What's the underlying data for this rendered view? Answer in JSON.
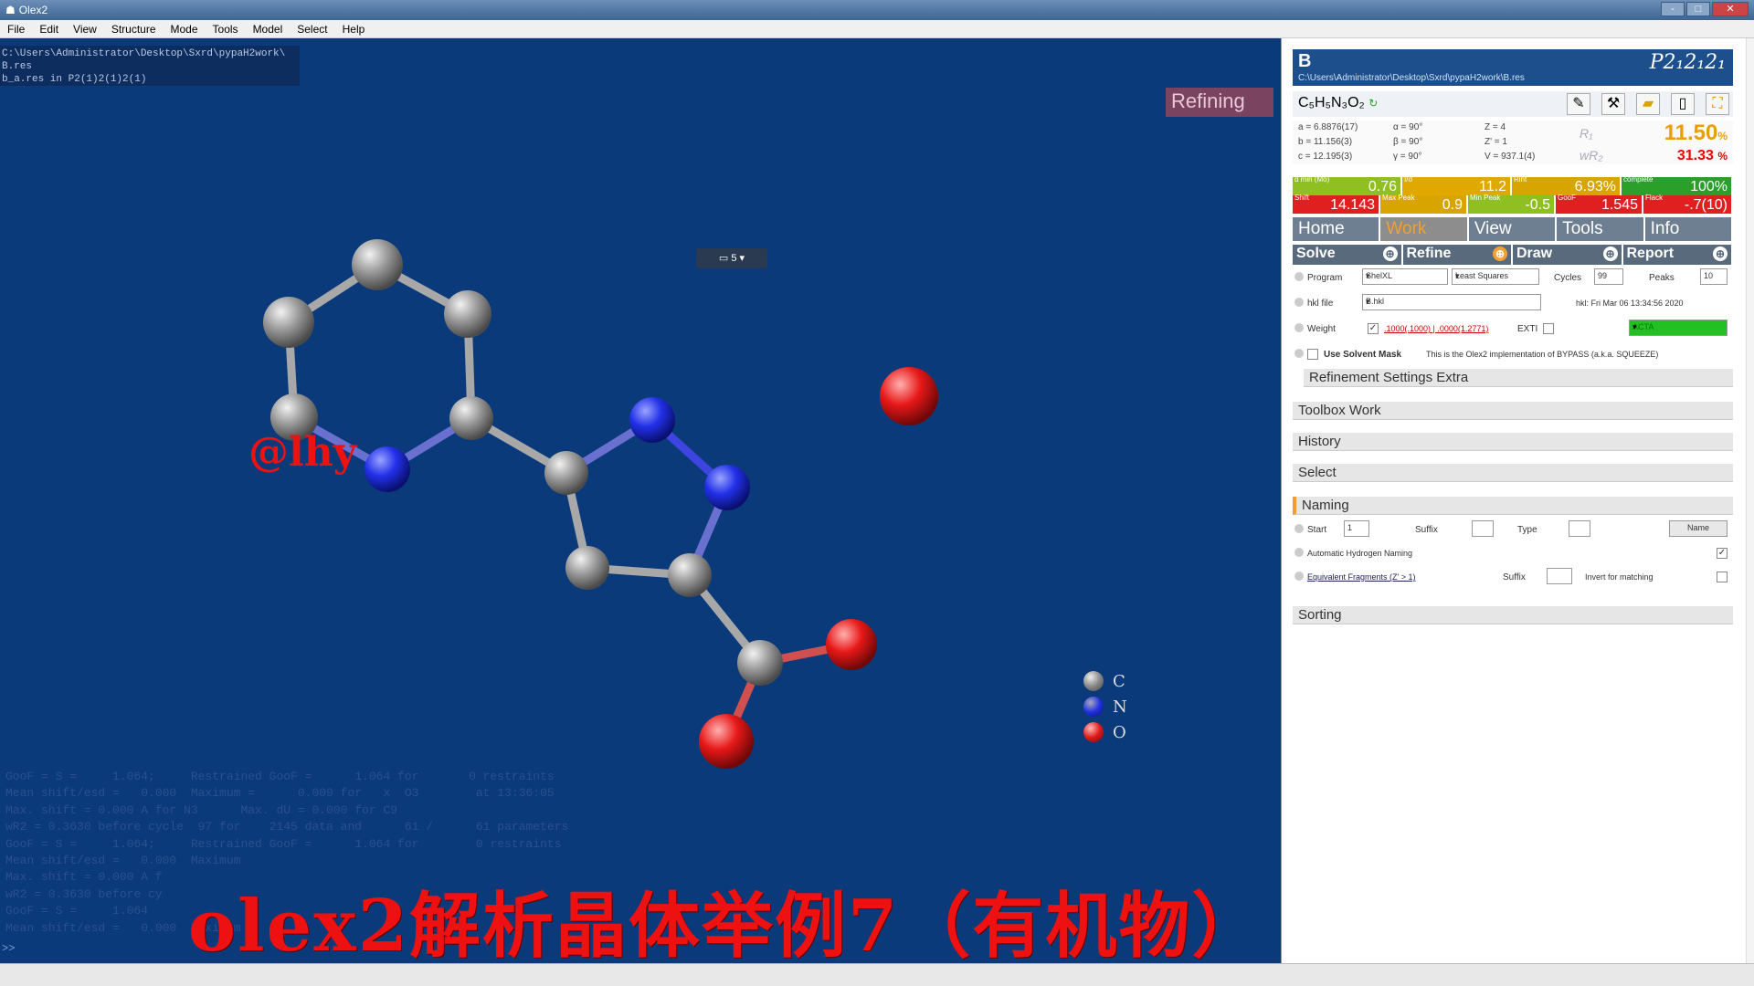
{
  "window": {
    "title": "Olex2",
    "min": "-",
    "max": "□",
    "close": "✕"
  },
  "menu": [
    "File",
    "Edit",
    "View",
    "Structure",
    "Mode",
    "Tools",
    "Model",
    "Select",
    "Help"
  ],
  "console_top": {
    "line1": "C:\\Users\\Administrator\\Desktop\\Sxrd\\pypaH2work\\",
    "line2": "B.res",
    "line3": "b_a.res  in P2(1)2(1)2(1)"
  },
  "refining_label": "Refining",
  "console_bottom": "GooF = S =     1.064;     Restrained GooF =      1.064 for       0 restraints\nMean shift/esd =   0.000  Maximum =      0.009 for   x  O3        at 13:36:05\nMax. shift = 0.000 A for N3      Max. dU = 0.000 for C9\nwR2 = 0.3630 before cycle  97 for    2145 data and      61 /      61 parameters\nGooF = S =     1.064;     Restrained GooF =      1.064 for        0 restraints\nMean shift/esd =   0.000  Maximum\nMax. shift = 0.000 A f\nwR2 = 0.3630 before cy\nGooF = S =     1.064\nMean shift/esd =   0.000  Maximum",
  "prompt": ">>",
  "overlay_title": "olex2解析晶体举例7（有机物）",
  "watermark_handle": "@lhy",
  "legend": [
    {
      "label": "C",
      "color": "#8a8a8a"
    },
    {
      "label": "N",
      "color": "#1f2fe0"
    },
    {
      "label": "O",
      "color": "#e01818"
    }
  ],
  "panel": {
    "name": "B",
    "space_group": "P2₁2₁2₁",
    "path": "C:\\Users\\Administrator\\Desktop\\Sxrd\\pypaH2work\\B.res",
    "formula": "C₅H₅N₃O₂",
    "cell": {
      "a": "a = 6.8876(17)",
      "b": "b = 11.156(3)",
      "c": "c = 12.195(3)",
      "alpha": "α = 90°",
      "beta": "β = 90°",
      "gamma": "γ = 90°",
      "Z": "Z = 4",
      "Zp": "Z' = 1",
      "V": "V = 937.1(4)"
    },
    "r1_label": "R₁",
    "r1": "11.50",
    "r1_unit": "%",
    "wr2_label": "wR₂",
    "wr2": "31.33",
    "wr2_unit": "%",
    "stats_row1": [
      {
        "label": "d min (Mo)",
        "value": "0.76",
        "color": "#8fbf20"
      },
      {
        "label": "I/σ",
        "value": "11.2",
        "color": "#e0a800"
      },
      {
        "label": "Rint",
        "value": "6.93%",
        "color": "#d8a400"
      },
      {
        "label": "complete",
        "value": "100%",
        "color": "#2aa02a"
      }
    ],
    "stats_row2": [
      {
        "label": "Shift",
        "value": "14.143",
        "color": "#e02020"
      },
      {
        "label": "Max Peak",
        "value": "0.9",
        "color": "#d8a400"
      },
      {
        "label": "Min Peak",
        "value": "-0.5",
        "color": "#8fbf20"
      },
      {
        "label": "GooF",
        "value": "1.545",
        "color": "#e02020"
      },
      {
        "label": "Flack",
        "value": "-.7(10)",
        "color": "#e02020"
      }
    ],
    "tabs": [
      "Home",
      "Work",
      "View",
      "Tools",
      "Info"
    ],
    "subtabs": [
      "Solve",
      "Refine",
      "Draw",
      "Report"
    ],
    "program_label": "Program",
    "program": "ShelXL",
    "method": "Least Squares",
    "cycles_label": "Cycles",
    "cycles": "99",
    "peaks_label": "Peaks",
    "peaks": "10",
    "hkl_label": "hkl file",
    "hkl": "B.hkl",
    "hkl_date": "hkl: Fri Mar 06 13:34:56 2020",
    "weight_label": "Weight",
    "weight_value": ".1000(.1000) | .0000(1.2771)",
    "exti_label": "EXTI",
    "acta": "ACTA",
    "solvent_label": "Use Solvent Mask",
    "solvent_note": "This is the Olex2 implementation of BYPASS (a.k.a. SQUEEZE)",
    "sections": [
      "Refinement Settings Extra",
      "Toolbox Work",
      "History",
      "Select",
      "Naming"
    ],
    "naming": {
      "start_label": "Start",
      "start": "1",
      "suffix_label": "Suffix",
      "type_label": "Type",
      "name_btn": "Name",
      "auto_h": "Automatic Hydrogen Naming",
      "equiv": "Equivalent Fragments (Z' > 1)",
      "suffix2_label": "Suffix",
      "invert": "Invert for matching"
    },
    "sorting": "Sorting"
  },
  "toolbar_icons": [
    "pencil-icon",
    "tools-icon",
    "folder-icon",
    "page-icon",
    "expand-icon"
  ]
}
